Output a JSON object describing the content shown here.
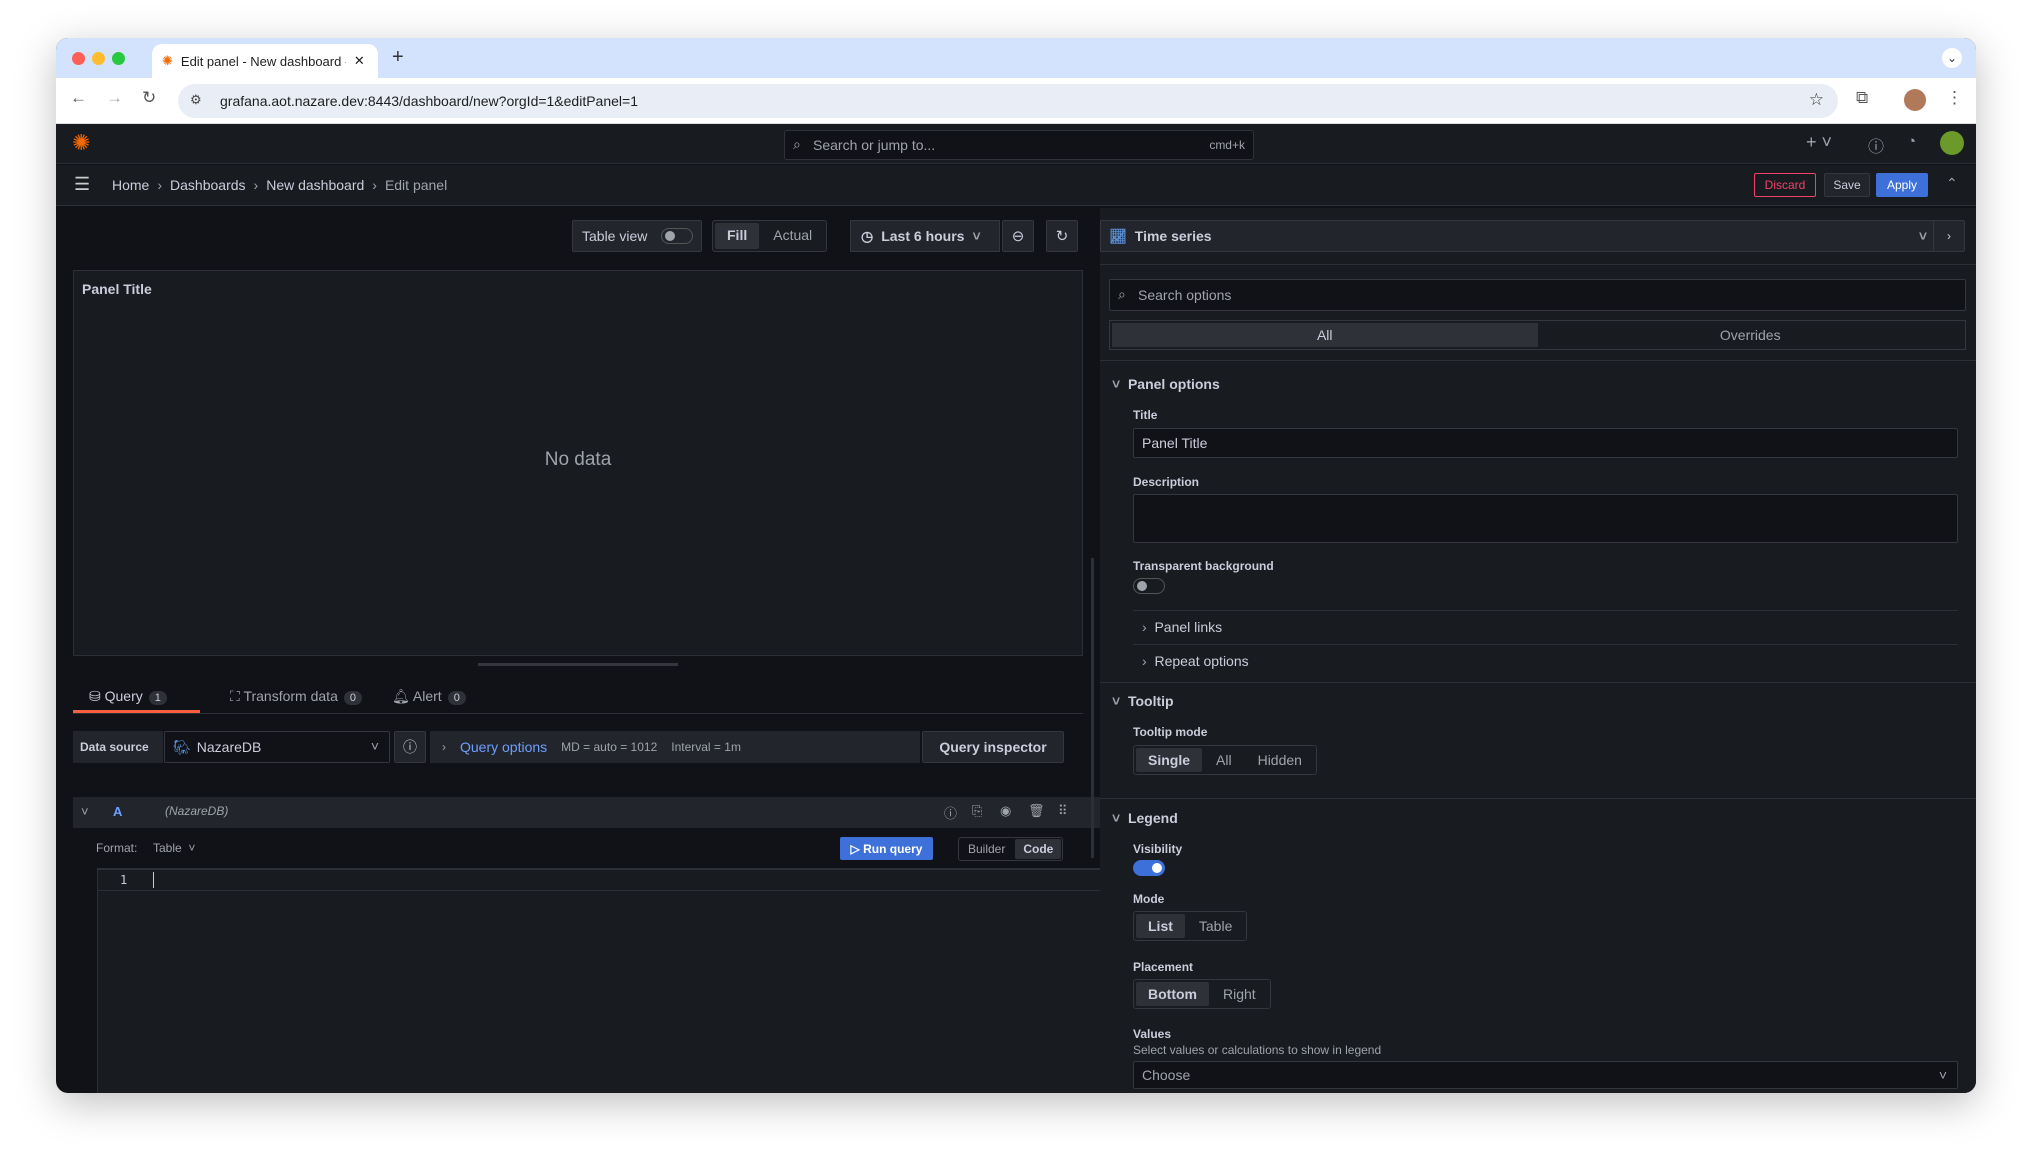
{
  "browser": {
    "tab_title": "Edit panel - New dashboard -",
    "url": "grafana.aot.nazare.dev:8443/dashboard/new?orgId=1&editPanel=1"
  },
  "topbar": {
    "search_placeholder": "Search or jump to...",
    "shortcut": "cmd+k"
  },
  "breadcrumb": [
    "Home",
    "Dashboards",
    "New dashboard",
    "Edit panel"
  ],
  "actions": {
    "discard": "Discard",
    "save": "Save",
    "apply": "Apply"
  },
  "toolbar": {
    "table_view": "Table view",
    "fill": "Fill",
    "actual": "Actual",
    "time_range": "Last 6 hours"
  },
  "panel": {
    "title": "Panel Title",
    "empty": "No data"
  },
  "query_tabs": [
    {
      "label": "Query",
      "count": "1"
    },
    {
      "label": "Transform data",
      "count": "0"
    },
    {
      "label": "Alert",
      "count": "0"
    }
  ],
  "datasource": {
    "label": "Data source",
    "value": "NazareDB",
    "query_options": "Query options",
    "md": "MD = auto = 1012",
    "interval": "Interval = 1m",
    "inspector": "Query inspector"
  },
  "query": {
    "ref": "A",
    "ds": "(NazareDB)",
    "format_label": "Format:",
    "format": "Table",
    "run": "Run query",
    "builder": "Builder",
    "code": "Code",
    "line": "1"
  },
  "viz": {
    "name": "Time series"
  },
  "options": {
    "search_placeholder": "Search options",
    "tabs": [
      "All",
      "Overrides"
    ],
    "panel_options": "Panel options",
    "title_label": "Title",
    "title_value": "Panel Title",
    "description_label": "Description",
    "transparent_label": "Transparent background",
    "transparent": false,
    "panel_links": "Panel links",
    "repeat_options": "Repeat options",
    "tooltip": "Tooltip",
    "tooltip_mode_label": "Tooltip mode",
    "tooltip_modes": [
      "Single",
      "All",
      "Hidden"
    ],
    "tooltip_selected": "Single",
    "legend": "Legend",
    "visibility_label": "Visibility",
    "visibility": true,
    "mode_label": "Mode",
    "modes": [
      "List",
      "Table"
    ],
    "placement_label": "Placement",
    "placements": [
      "Bottom",
      "Right"
    ],
    "values_label": "Values",
    "values_desc": "Select values or calculations to show in legend",
    "values_placeholder": "Choose"
  },
  "colors": {
    "accent": "#3d71d9",
    "discard": "#f0436a",
    "tab_underline": "#f55f3e",
    "link": "#6e9fff"
  }
}
